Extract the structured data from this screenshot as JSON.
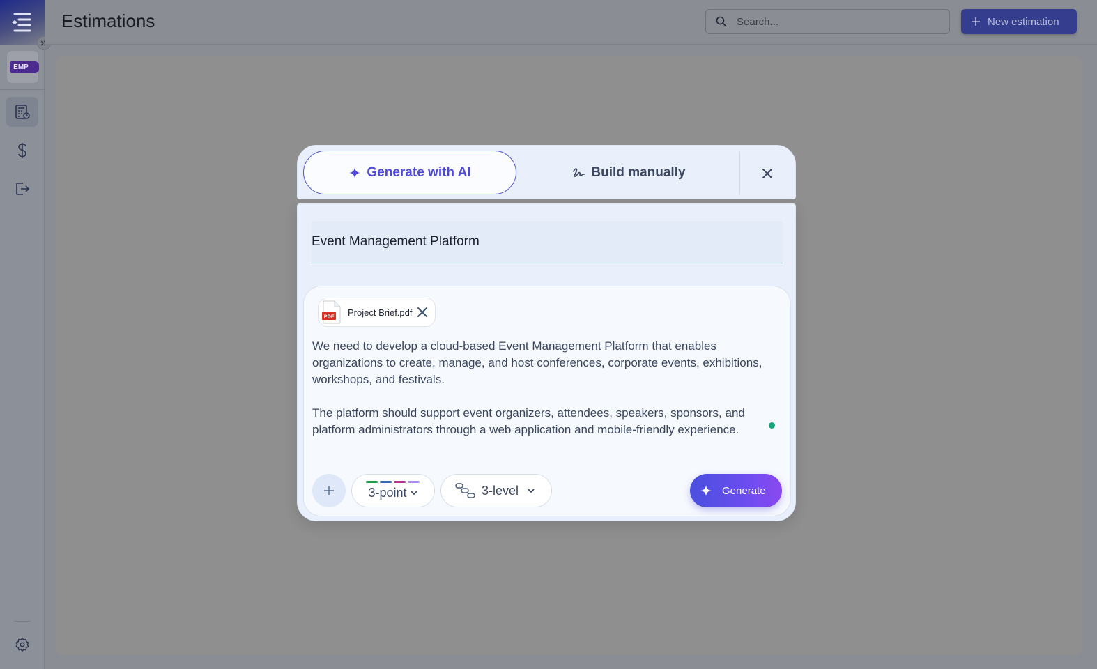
{
  "app": {
    "project_badge": "EMP"
  },
  "header": {
    "title": "Estimations",
    "search_placeholder": "Search...",
    "new_button_label": "New estimation"
  },
  "sidebar": {
    "items": [
      {
        "name": "estimations",
        "icon": "calculator-icon",
        "active": true
      },
      {
        "name": "pricing",
        "icon": "dollar-icon",
        "active": false
      },
      {
        "name": "logout",
        "icon": "logout-icon",
        "active": false
      }
    ],
    "bottom_icon": "gear-icon"
  },
  "modal": {
    "tab_ai_label": "Generate with AI",
    "tab_manual_label": "Build manually",
    "estimation_name": "Event Management Platform",
    "attachment": {
      "file_name": "Project Brief.pdf",
      "file_type": "PDF"
    },
    "prompt": "We need to develop a cloud-based Event Management Platform that enables organizations to create, manage, and host conferences, corporate events, exhibitions, workshops, and festivals.\n\nThe platform should support event organizers, attendees, speakers, sponsors, and platform administrators through a web application and mobile-friendly experience.",
    "estimation_type": "3-point",
    "estimation_type_colors": [
      "#1e9e46",
      "#3b64b0",
      "#b23a8a",
      "#a68ee8"
    ],
    "hierarchy_level": "3-level",
    "generate_label": "Generate"
  },
  "colors": {
    "accent": "#4f49d8",
    "primary_button": "#353d8e",
    "status_dot": "#14a77a"
  }
}
